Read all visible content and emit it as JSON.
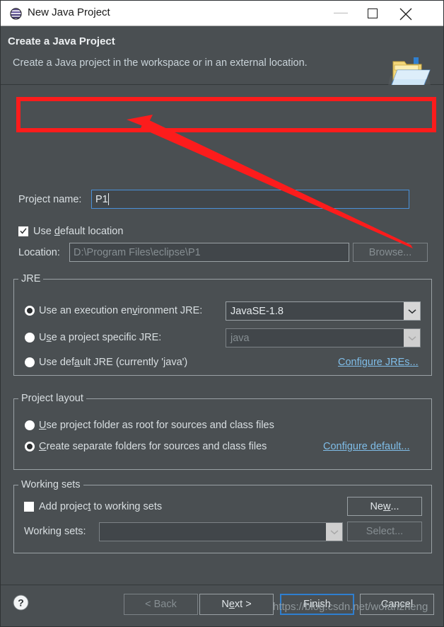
{
  "window": {
    "title": "New Java Project",
    "icon": "eclipse-sphere-icon",
    "controls": {
      "minimize": "minimize-icon",
      "maximize": "maximize-icon",
      "close": "close-icon"
    }
  },
  "banner": {
    "title": "Create a Java Project",
    "subtitle": "Create a Java project in the workspace or in an external location.",
    "icon": "java-project-folder-icon"
  },
  "project_name": {
    "label": "Project name:",
    "value": "P1",
    "focused": true
  },
  "default_location": {
    "label_pre": "Use ",
    "label_mnemonic": "d",
    "label_post": "efault location",
    "checked": true
  },
  "location": {
    "label": "Location:",
    "value": "D:\\Program Files\\eclipse\\P1",
    "is_placeholder": true,
    "browse_label": "Browse...",
    "browse_enabled": false
  },
  "jre": {
    "group_title": "JRE",
    "options": [
      {
        "label_pre": "Use an execution en",
        "label_mnemonic": "v",
        "label_post": "ironment JRE:",
        "selected": true
      },
      {
        "label_pre": "U",
        "label_mnemonic": "s",
        "label_post": "e a project specific JRE:",
        "selected": false
      },
      {
        "label_pre": "Use def",
        "label_mnemonic": "a",
        "label_post": "ult JRE (currently 'java')",
        "selected": false
      }
    ],
    "execution_env_value": "JavaSE-1.8",
    "project_jre_value": "java",
    "project_jre_enabled": false,
    "configure_link": "Configure JREs..."
  },
  "project_layout": {
    "group_title": "Project layout",
    "options": [
      {
        "label_pre": "",
        "label_mnemonic": "U",
        "label_post": "se project folder as root for sources and class files",
        "selected": false
      },
      {
        "label_pre": "",
        "label_mnemonic": "C",
        "label_post": "reate separate folders for sources and class files",
        "selected": true
      }
    ],
    "configure_link": "Configure default..."
  },
  "working_sets": {
    "group_title": "Working sets",
    "add_checkbox": {
      "label_pre": "Add projec",
      "label_mnemonic": "t",
      "label_post": " to working sets",
      "checked": false
    },
    "combo_label": "Working sets:",
    "combo_value": "",
    "combo_enabled": false,
    "new_button": {
      "label_pre": "Ne",
      "label_mnemonic": "w",
      "label_post": "...",
      "enabled": true
    },
    "select_button": {
      "label": "Select...",
      "enabled": false
    }
  },
  "footer": {
    "help_icon": "help-question-icon",
    "buttons": [
      {
        "name": "back",
        "label_pre": "< Back",
        "label_mnemonic": "",
        "label_post": "",
        "enabled": false,
        "default": false
      },
      {
        "name": "next",
        "label_pre": "N",
        "label_mnemonic": "e",
        "label_post": "xt >",
        "enabled": true,
        "default": false
      },
      {
        "name": "finish",
        "label_pre": "Finish",
        "label_mnemonic": "",
        "label_post": "",
        "enabled": true,
        "default": true
      },
      {
        "name": "cancel",
        "label_pre": "Cancel",
        "label_mnemonic": "",
        "label_post": "",
        "enabled": true,
        "default": false
      }
    ]
  },
  "annotations": {
    "highlight_color": "#fc1c1c",
    "arrow_color": "#fc1c1c",
    "watermark": "https://blog.csdn.net/wofanzheng"
  },
  "theme": {
    "dialog_bg": "#4a4f52",
    "titlebar_bg": "#ffffff",
    "text": "#d9dfe2",
    "link": "#7fbde8",
    "focus_border": "#4a90d9"
  }
}
